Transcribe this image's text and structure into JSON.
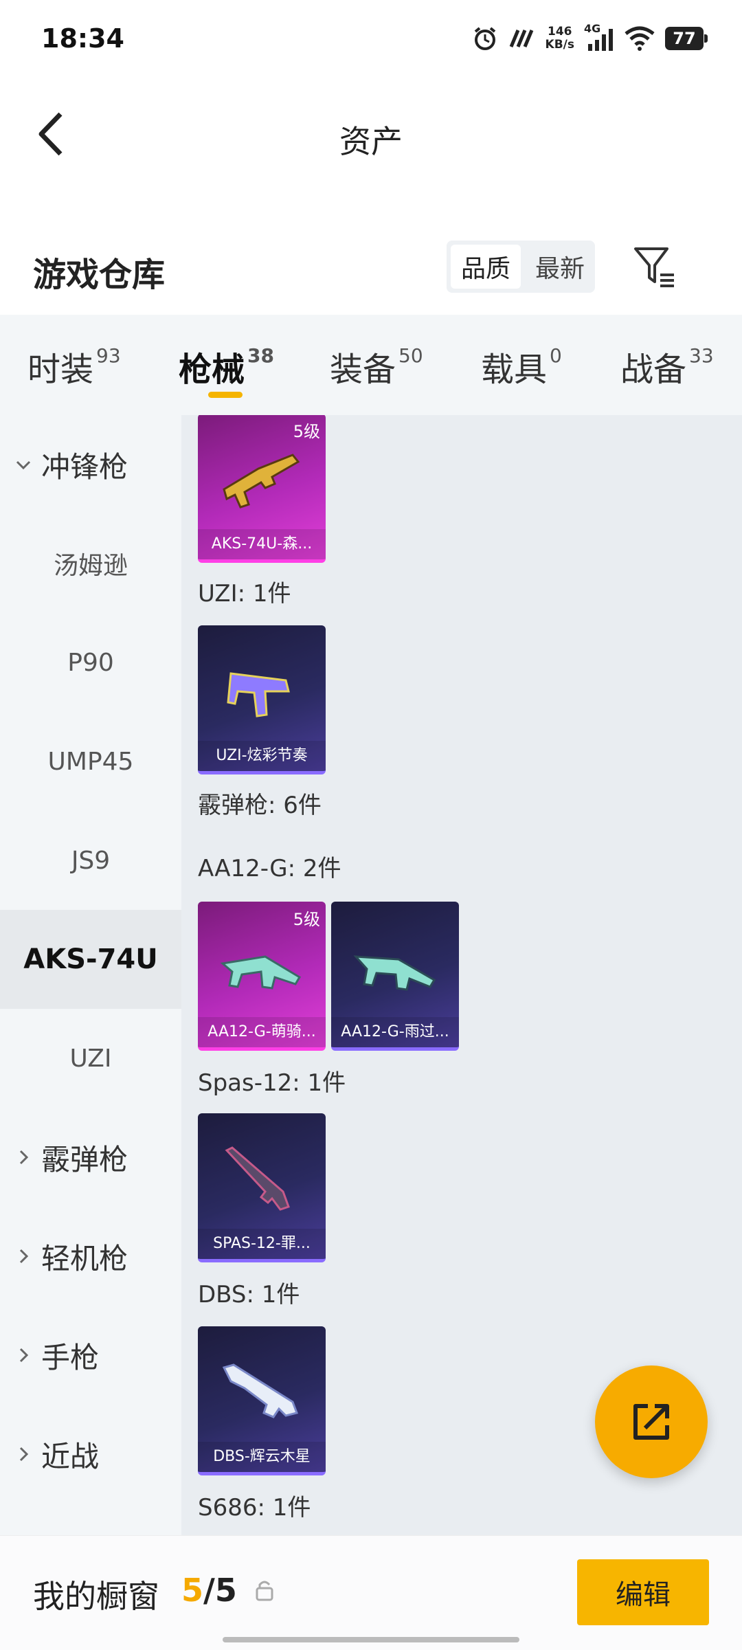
{
  "status_bar": {
    "time": "18:34",
    "net_speed_value": "146",
    "net_speed_unit": "KB/s",
    "network": "4G",
    "battery": "77",
    "icons": [
      "alarm-icon",
      "app-icon",
      "signal-icon",
      "wifi-icon",
      "battery-icon"
    ]
  },
  "header": {
    "title": "资产"
  },
  "warehouse": {
    "title": "游戏仓库",
    "sort": {
      "quality": "品质",
      "latest": "最新",
      "active": "品质"
    }
  },
  "tabs": [
    {
      "label": "时装",
      "count": "93"
    },
    {
      "label": "枪械",
      "count": "38",
      "active": true
    },
    {
      "label": "装备",
      "count": "50"
    },
    {
      "label": "载具",
      "count": "0"
    },
    {
      "label": "战备",
      "count": "33"
    }
  ],
  "sidebar": {
    "items": [
      {
        "label": "冲锋枪",
        "type": "category",
        "expanded": true
      },
      {
        "label": "汤姆逊"
      },
      {
        "label": "P90"
      },
      {
        "label": "UMP45"
      },
      {
        "label": "JS9"
      },
      {
        "label": "AKS-74U",
        "active": true
      },
      {
        "label": "UZI"
      },
      {
        "label": "霰弹枪",
        "type": "category"
      },
      {
        "label": "轻机枪",
        "type": "category"
      },
      {
        "label": "手枪",
        "type": "category"
      },
      {
        "label": "近战",
        "type": "category"
      }
    ]
  },
  "content": {
    "cards": [
      {
        "name": "AKS-74U-森...",
        "level": "5级",
        "rarity": "pink"
      },
      {
        "name": "UZI-炫彩节奏",
        "level": "",
        "rarity": "purple"
      },
      {
        "name": "AA12-G-萌骑...",
        "level": "5级",
        "rarity": "pink"
      },
      {
        "name": "AA12-G-雨过...",
        "level": "",
        "rarity": "purple"
      },
      {
        "name": "SPAS-12-罪...",
        "level": "",
        "rarity": "purple"
      },
      {
        "name": "DBS-辉云木星",
        "level": "",
        "rarity": "purple"
      }
    ],
    "labels": [
      "UZI: 1件",
      "霰弹枪: 6件",
      "AA12-G: 2件",
      "Spas-12: 1件",
      "DBS: 1件",
      "S686: 1件"
    ]
  },
  "bottom": {
    "title": "我的橱窗",
    "current": "5",
    "sep": "/",
    "total": "5",
    "edit_label": "编辑"
  },
  "colors": {
    "accent": "#f5b400",
    "fab": "#f7ab00",
    "pink_card": "#b22ab8",
    "purple_card": "#2a2a60"
  }
}
